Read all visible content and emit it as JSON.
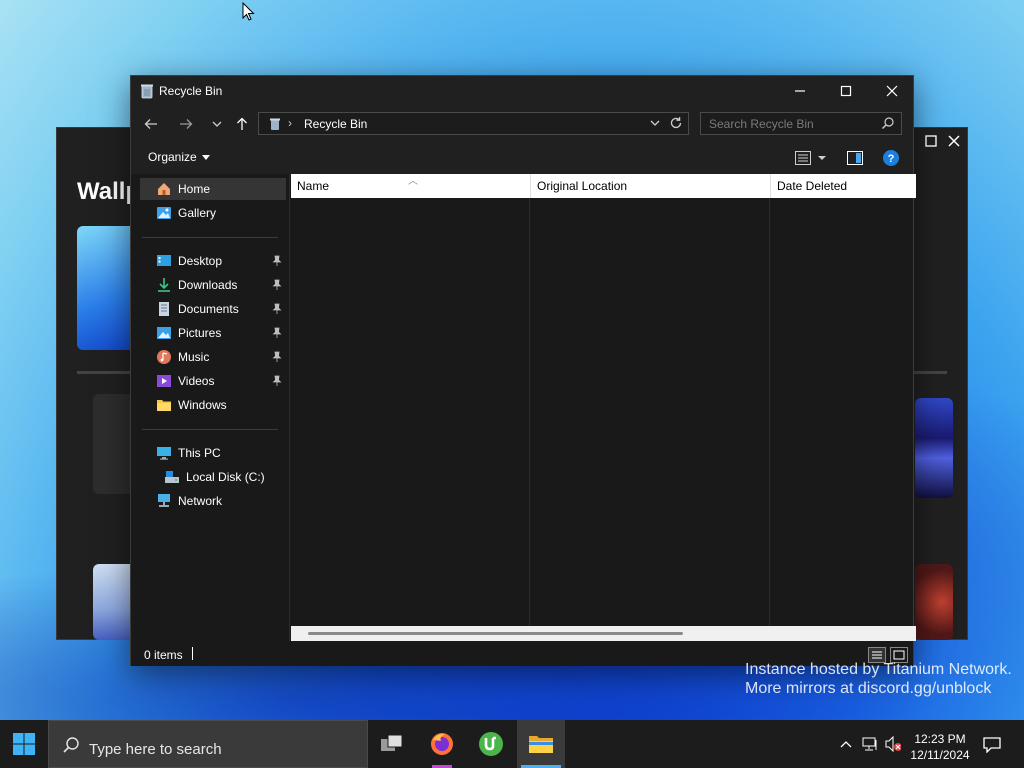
{
  "background_window": {
    "title": "Wallp"
  },
  "explorer": {
    "title": "Recycle Bin",
    "address": {
      "crumb": "Recycle Bin"
    },
    "search": {
      "placeholder": "Search Recycle Bin"
    },
    "command_bar": {
      "organize_label": "Organize"
    },
    "nav": {
      "home": "Home",
      "gallery": "Gallery",
      "quick_access": [
        "Desktop",
        "Downloads",
        "Documents",
        "Pictures",
        "Music",
        "Videos",
        "Windows"
      ],
      "this_pc": "This PC",
      "local_disk": "Local Disk (C:)",
      "network": "Network"
    },
    "columns": [
      "Name",
      "Original Location",
      "Date Deleted"
    ],
    "status": {
      "item_count": "0 items"
    }
  },
  "watermark": {
    "line1": "Instance hosted by Titanium Network.",
    "line2": "More mirrors at discord.gg/unblock"
  },
  "taskbar": {
    "search_placeholder": "Type here to search",
    "clock_time": "12:23 PM",
    "clock_date": "12/11/2024",
    "apps": [
      "task-view",
      "firefox",
      "utorrent",
      "file-explorer"
    ]
  },
  "colors": {
    "accent": "#0078d4",
    "titlebar": "#202020",
    "window_bg": "#191919"
  }
}
